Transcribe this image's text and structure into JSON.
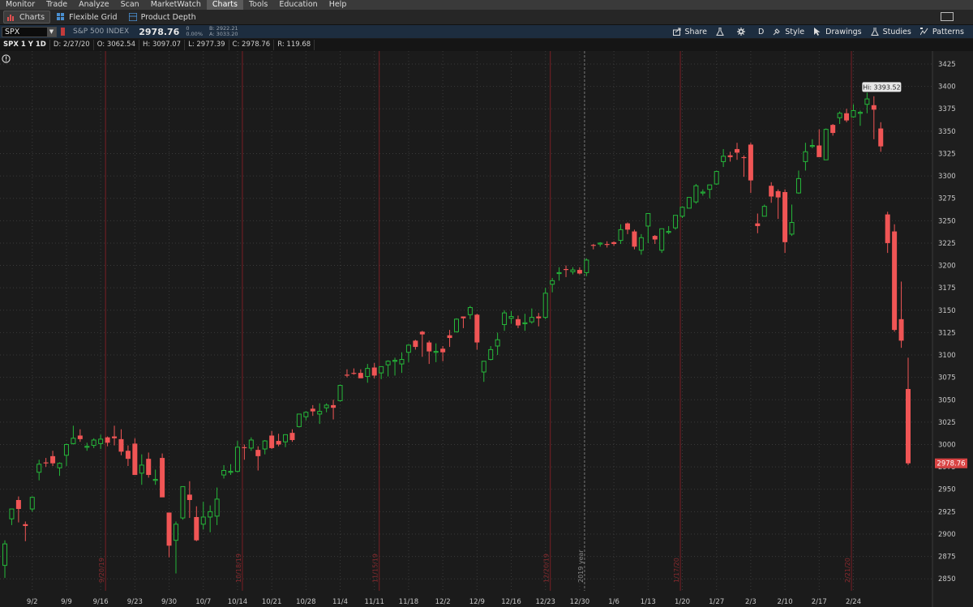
{
  "menu": [
    "Monitor",
    "Trade",
    "Analyze",
    "Scan",
    "MarketWatch",
    "Charts",
    "Tools",
    "Education",
    "Help"
  ],
  "menu_active": "Charts",
  "tabs": [
    {
      "label": "Charts",
      "icon": "bar-chart-icon"
    },
    {
      "label": "Flexible Grid",
      "icon": "grid-icon"
    },
    {
      "label": "Product Depth",
      "icon": "depth-icon"
    }
  ],
  "symbol": {
    "value": "SPX",
    "description": "S&P 500 INDEX",
    "last": "2978.76",
    "change": "0",
    "change_pct": "0.00%",
    "bid": "B: 2922.21",
    "ask": "A: 3033.20"
  },
  "toolbar": {
    "share": "Share",
    "period": "D",
    "style": "Style",
    "drawings": "Drawings",
    "studies": "Studies",
    "patterns": "Patterns"
  },
  "ohlc": {
    "title": "SPX 1 Y 1D",
    "date": "D: 2/27/20",
    "open": "O: 3062.54",
    "high": "H: 3097.07",
    "low": "L: 2977.39",
    "close": "C: 2978.76",
    "range": "R: 119.68"
  },
  "colors": {
    "up": "#25b83a",
    "down": "#f05555",
    "grid": "#3a3a3a",
    "bg": "#1b1b1b",
    "marker": "#7a1f24"
  },
  "chart_data": {
    "type": "candlestick",
    "hi_label": "Hi: 3393.52",
    "last_label": "2978.76",
    "y_ticks": [
      3425,
      3400,
      3375,
      3350,
      3325,
      3300,
      3275,
      3250,
      3225,
      3200,
      3175,
      3150,
      3125,
      3100,
      3075,
      3050,
      3025,
      3000,
      2975,
      2950,
      2925,
      2900,
      2875,
      2850
    ],
    "x_ticks": [
      "9/2",
      "9/9",
      "9/16",
      "9/23",
      "9/30",
      "10/7",
      "10/14",
      "10/21",
      "10/28",
      "11/4",
      "11/11",
      "11/18",
      "12/2",
      "12/9",
      "12/16",
      "12/23",
      "12/30",
      "1/6",
      "1/13",
      "1/20",
      "1/27",
      "2/3",
      "2/10",
      "2/17",
      "2/24"
    ],
    "markers": [
      "9/20/19",
      "10/18/19",
      "11/15/19",
      "12/20/19",
      "2019 year",
      "1/17/20",
      "2/21/20"
    ],
    "candles": [
      {
        "o": 2865,
        "h": 2893,
        "l": 2851,
        "c": 2889
      },
      {
        "o": 2917,
        "h": 2928,
        "l": 2910,
        "c": 2928
      },
      {
        "o": 2938,
        "h": 2942,
        "l": 2913,
        "c": 2928
      },
      {
        "o": 2911,
        "h": 2914,
        "l": 2892,
        "c": 2909
      },
      {
        "o": 2928,
        "h": 2942,
        "l": 2925,
        "c": 2941
      },
      {
        "o": 2969,
        "h": 2983,
        "l": 2960,
        "c": 2978
      },
      {
        "o": 2980,
        "h": 2985,
        "l": 2975,
        "c": 2979
      },
      {
        "o": 2987,
        "h": 2993,
        "l": 2976,
        "c": 2979
      },
      {
        "o": 2974,
        "h": 2980,
        "l": 2965,
        "c": 2979
      },
      {
        "o": 2988,
        "h": 3001,
        "l": 2976,
        "c": 3000
      },
      {
        "o": 3001,
        "h": 3021,
        "l": 3000,
        "c": 3007
      },
      {
        "o": 3010,
        "h": 3017,
        "l": 3003,
        "c": 3006
      },
      {
        "o": 2998,
        "h": 3002,
        "l": 2993,
        "c": 2998
      },
      {
        "o": 2999,
        "h": 3007,
        "l": 2996,
        "c": 3005
      },
      {
        "o": 3001,
        "h": 3011,
        "l": 2995,
        "c": 3006
      },
      {
        "o": 3008,
        "h": 3009,
        "l": 2998,
        "c": 3002
      },
      {
        "o": 3009,
        "h": 3021,
        "l": 2999,
        "c": 3007
      },
      {
        "o": 3006,
        "h": 3017,
        "l": 2988,
        "c": 2992
      },
      {
        "o": 2993,
        "h": 2999,
        "l": 2976,
        "c": 2984
      },
      {
        "o": 3001,
        "h": 3007,
        "l": 2975,
        "c": 2966
      },
      {
        "o": 2968,
        "h": 2989,
        "l": 2955,
        "c": 2977
      },
      {
        "o": 2984,
        "h": 2991,
        "l": 2963,
        "c": 2966
      },
      {
        "o": 2960,
        "h": 2972,
        "l": 2955,
        "c": 2961
      },
      {
        "o": 2985,
        "h": 2990,
        "l": 2950,
        "c": 2941
      },
      {
        "o": 2924,
        "h": 2924,
        "l": 2874,
        "c": 2887
      },
      {
        "o": 2893,
        "h": 2914,
        "l": 2856,
        "c": 2911
      },
      {
        "o": 2918,
        "h": 2953,
        "l": 2916,
        "c": 2953
      },
      {
        "o": 2944,
        "h": 2959,
        "l": 2918,
        "c": 2938
      },
      {
        "o": 2919,
        "h": 2931,
        "l": 2892,
        "c": 2893
      },
      {
        "o": 2911,
        "h": 2936,
        "l": 2905,
        "c": 2919
      },
      {
        "o": 2919,
        "h": 2932,
        "l": 2902,
        "c": 2925
      },
      {
        "o": 2920,
        "h": 2952,
        "l": 2910,
        "c": 2939
      },
      {
        "o": 2966,
        "h": 2977,
        "l": 2962,
        "c": 2971
      },
      {
        "o": 2969,
        "h": 2978,
        "l": 2966,
        "c": 2970
      },
      {
        "o": 2970,
        "h": 3004,
        "l": 2969,
        "c": 2997
      },
      {
        "o": 2997,
        "h": 3000,
        "l": 2983,
        "c": 2996
      },
      {
        "o": 2996,
        "h": 3008,
        "l": 2993,
        "c": 3005
      },
      {
        "o": 2994,
        "h": 2998,
        "l": 2971,
        "c": 2987
      },
      {
        "o": 2995,
        "h": 3005,
        "l": 2989,
        "c": 3004
      },
      {
        "o": 3010,
        "h": 3015,
        "l": 2995,
        "c": 2996
      },
      {
        "o": 3004,
        "h": 3012,
        "l": 2998,
        "c": 3000
      },
      {
        "o": 3003,
        "h": 3011,
        "l": 2997,
        "c": 3011
      },
      {
        "o": 3013,
        "h": 3017,
        "l": 3003,
        "c": 3005
      },
      {
        "o": 3020,
        "h": 3034,
        "l": 3019,
        "c": 3034
      },
      {
        "o": 3031,
        "h": 3037,
        "l": 3027,
        "c": 3036
      },
      {
        "o": 3040,
        "h": 3044,
        "l": 3032,
        "c": 3037
      },
      {
        "o": 3034,
        "h": 3046,
        "l": 3023,
        "c": 3037
      },
      {
        "o": 3041,
        "h": 3046,
        "l": 3036,
        "c": 3044
      },
      {
        "o": 3044,
        "h": 3050,
        "l": 3028,
        "c": 3041
      },
      {
        "o": 3049,
        "h": 3067,
        "l": 3048,
        "c": 3066
      },
      {
        "o": 3078,
        "h": 3084,
        "l": 3075,
        "c": 3077
      },
      {
        "o": 3080,
        "h": 3085,
        "l": 3078,
        "c": 3079
      },
      {
        "o": 3080,
        "h": 3084,
        "l": 3075,
        "c": 3074
      },
      {
        "o": 3076,
        "h": 3090,
        "l": 3069,
        "c": 3085
      },
      {
        "o": 3086,
        "h": 3091,
        "l": 3074,
        "c": 3077
      },
      {
        "o": 3080,
        "h": 3085,
        "l": 3073,
        "c": 3087
      },
      {
        "o": 3089,
        "h": 3094,
        "l": 3076,
        "c": 3093
      },
      {
        "o": 3093,
        "h": 3097,
        "l": 3077,
        "c": 3094
      },
      {
        "o": 3090,
        "h": 3103,
        "l": 3080,
        "c": 3095
      },
      {
        "o": 3103,
        "h": 3112,
        "l": 3092,
        "c": 3111
      },
      {
        "o": 3116,
        "h": 3117,
        "l": 3106,
        "c": 3109
      },
      {
        "o": 3126,
        "h": 3127,
        "l": 3098,
        "c": 3123
      },
      {
        "o": 3114,
        "h": 3116,
        "l": 3090,
        "c": 3104
      },
      {
        "o": 3103,
        "h": 3113,
        "l": 3092,
        "c": 3104
      },
      {
        "o": 3107,
        "h": 3110,
        "l": 3093,
        "c": 3103
      },
      {
        "o": 3122,
        "h": 3128,
        "l": 3109,
        "c": 3119
      },
      {
        "o": 3126,
        "h": 3141,
        "l": 3125,
        "c": 3140
      },
      {
        "o": 3143,
        "h": 3143,
        "l": 3130,
        "c": 3141
      },
      {
        "o": 3145,
        "h": 3155,
        "l": 3140,
        "c": 3153
      },
      {
        "o": 3145,
        "h": 3146,
        "l": 3106,
        "c": 3114
      },
      {
        "o": 3081,
        "h": 3093,
        "l": 3070,
        "c": 3093
      },
      {
        "o": 3095,
        "h": 3110,
        "l": 3094,
        "c": 3106
      },
      {
        "o": 3110,
        "h": 3125,
        "l": 3100,
        "c": 3117
      },
      {
        "o": 3134,
        "h": 3150,
        "l": 3127,
        "c": 3147
      },
      {
        "o": 3141,
        "h": 3149,
        "l": 3135,
        "c": 3143
      },
      {
        "o": 3140,
        "h": 3144,
        "l": 3130,
        "c": 3133
      },
      {
        "o": 3135,
        "h": 3146,
        "l": 3127,
        "c": 3136
      },
      {
        "o": 3137,
        "h": 3152,
        "l": 3135,
        "c": 3142
      },
      {
        "o": 3143,
        "h": 3147,
        "l": 3132,
        "c": 3141
      },
      {
        "o": 3142,
        "h": 3175,
        "l": 3140,
        "c": 3169
      },
      {
        "o": 3179,
        "h": 3186,
        "l": 3170,
        "c": 3183
      },
      {
        "o": 3192,
        "h": 3198,
        "l": 3183,
        "c": 3192
      },
      {
        "o": 3196,
        "h": 3200,
        "l": 3187,
        "c": 3195
      },
      {
        "o": 3193,
        "h": 3198,
        "l": 3190,
        "c": 3195
      },
      {
        "o": 3195,
        "h": 3198,
        "l": 3190,
        "c": 3191
      },
      {
        "o": 3192,
        "h": 3208,
        "l": 3188,
        "c": 3206
      },
      {
        "o": 3223,
        "h": 3224,
        "l": 3218,
        "c": 3222
      },
      {
        "o": 3224,
        "h": 3226,
        "l": 3221,
        "c": 3225
      },
      {
        "o": 3224,
        "h": 3227,
        "l": 3220,
        "c": 3223
      },
      {
        "o": 3226,
        "h": 3227,
        "l": 3222,
        "c": 3224
      },
      {
        "o": 3228,
        "h": 3246,
        "l": 3224,
        "c": 3240
      },
      {
        "o": 3247,
        "h": 3248,
        "l": 3235,
        "c": 3240
      },
      {
        "o": 3238,
        "h": 3240,
        "l": 3218,
        "c": 3221
      },
      {
        "o": 3217,
        "h": 3235,
        "l": 3212,
        "c": 3231
      },
      {
        "o": 3244,
        "h": 3246,
        "l": 3225,
        "c": 3258
      },
      {
        "o": 3233,
        "h": 3234,
        "l": 3224,
        "c": 3229
      },
      {
        "o": 3217,
        "h": 3240,
        "l": 3214,
        "c": 3241
      },
      {
        "o": 3238,
        "h": 3244,
        "l": 3235,
        "c": 3238
      },
      {
        "o": 3242,
        "h": 3256,
        "l": 3240,
        "c": 3256
      },
      {
        "o": 3255,
        "h": 3266,
        "l": 3253,
        "c": 3265
      },
      {
        "o": 3264,
        "h": 3276,
        "l": 3264,
        "c": 3276
      },
      {
        "o": 3271,
        "h": 3291,
        "l": 3269,
        "c": 3289
      },
      {
        "o": 3281,
        "h": 3285,
        "l": 3278,
        "c": 3282
      },
      {
        "o": 3285,
        "h": 3289,
        "l": 3275,
        "c": 3290
      },
      {
        "o": 3291,
        "h": 3306,
        "l": 3290,
        "c": 3305
      },
      {
        "o": 3316,
        "h": 3330,
        "l": 3310,
        "c": 3322
      },
      {
        "o": 3323,
        "h": 3327,
        "l": 3316,
        "c": 3321
      },
      {
        "o": 3330,
        "h": 3337,
        "l": 3318,
        "c": 3326
      },
      {
        "o": 3321,
        "h": 3323,
        "l": 3299,
        "c": 3320
      },
      {
        "o": 3335,
        "h": 3337,
        "l": 3281,
        "c": 3295
      },
      {
        "o": 3247,
        "h": 3258,
        "l": 3236,
        "c": 3244
      },
      {
        "o": 3255,
        "h": 3268,
        "l": 3255,
        "c": 3266
      },
      {
        "o": 3289,
        "h": 3293,
        "l": 3270,
        "c": 3277
      },
      {
        "o": 3283,
        "h": 3285,
        "l": 3252,
        "c": 3276
      },
      {
        "o": 3282,
        "h": 3285,
        "l": 3214,
        "c": 3226
      },
      {
        "o": 3235,
        "h": 3268,
        "l": 3233,
        "c": 3248
      },
      {
        "o": 3281,
        "h": 3306,
        "l": 3280,
        "c": 3297
      },
      {
        "o": 3316,
        "h": 3337,
        "l": 3306,
        "c": 3327
      },
      {
        "o": 3334,
        "h": 3341,
        "l": 3331,
        "c": 3334
      },
      {
        "o": 3334,
        "h": 3352,
        "l": 3327,
        "c": 3321
      },
      {
        "o": 3318,
        "h": 3353,
        "l": 3318,
        "c": 3352
      },
      {
        "o": 3357,
        "h": 3358,
        "l": 3345,
        "c": 3348
      },
      {
        "o": 3365,
        "h": 3372,
        "l": 3358,
        "c": 3370
      },
      {
        "o": 3370,
        "h": 3375,
        "l": 3360,
        "c": 3362
      },
      {
        "o": 3366,
        "h": 3380,
        "l": 3365,
        "c": 3373
      },
      {
        "o": 3370,
        "h": 3373,
        "l": 3356,
        "c": 3371
      },
      {
        "o": 3380,
        "h": 3393,
        "l": 3370,
        "c": 3386
      },
      {
        "o": 3379,
        "h": 3389,
        "l": 3341,
        "c": 3374
      },
      {
        "o": 3353,
        "h": 3360,
        "l": 3327,
        "c": 3333
      },
      {
        "o": 3257,
        "h": 3260,
        "l": 3214,
        "c": 3225
      },
      {
        "o": 3238,
        "h": 3246,
        "l": 3126,
        "c": 3128
      },
      {
        "o": 3140,
        "h": 3182,
        "l": 3108,
        "c": 3116
      },
      {
        "o": 3062,
        "h": 3097,
        "l": 2977,
        "c": 2979
      }
    ]
  }
}
